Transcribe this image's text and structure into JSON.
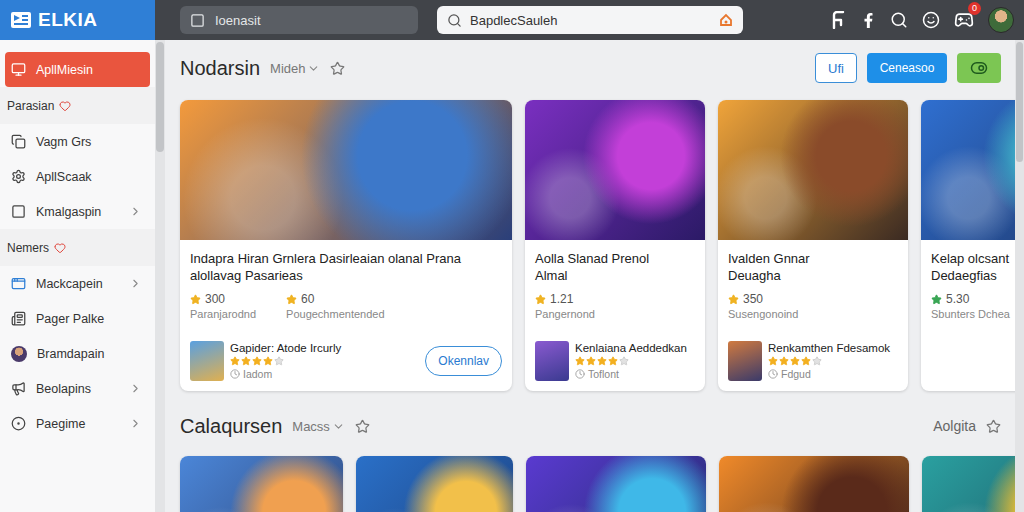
{
  "logo": {
    "text": "ELKIA"
  },
  "top_bar": {
    "search_left": {
      "value": "Ioenasit"
    },
    "search_main": {
      "value": "BapdlecSauleh"
    },
    "notification_badge": "0"
  },
  "sidebar": {
    "items": [
      {
        "kind": "item",
        "label": "ApllMiesin",
        "selected": true,
        "expandable": false
      },
      {
        "kind": "section",
        "label": "Parasian"
      },
      {
        "kind": "item",
        "label": "Vagm Grs",
        "selected": false,
        "expandable": false
      },
      {
        "kind": "item",
        "label": "ApllScaak",
        "selected": false,
        "expandable": false
      },
      {
        "kind": "item",
        "label": "Kmalgaspin",
        "selected": false,
        "expandable": true
      },
      {
        "kind": "section",
        "label": "Nemers"
      },
      {
        "kind": "item",
        "label": "Mackcapein",
        "selected": false,
        "expandable": true
      },
      {
        "kind": "item",
        "label": "Pager Palke",
        "selected": false,
        "expandable": false
      },
      {
        "kind": "item",
        "label": "Bramdapain",
        "selected": false,
        "expandable": false
      },
      {
        "kind": "item",
        "label": "Beolapins",
        "selected": false,
        "expandable": true
      },
      {
        "kind": "item",
        "label": "Paegime",
        "selected": false,
        "expandable": true
      }
    ]
  },
  "sections": [
    {
      "title": "Nodarsin",
      "filter": "Mideh",
      "buttons": [
        "Ufi",
        "Ceneasoo"
      ],
      "cards": [
        {
          "kind": "game",
          "title_lines": [
            "Indapra Hiran Grnlera Dasirleaian olanal Prana",
            "alollavag Pasarieas"
          ],
          "ratings": [
            {
              "value": "300",
              "caption": "Paranjarodnd",
              "color": "#f0b323"
            },
            {
              "value": "60",
              "caption": "Pougechmentended",
              "color": "#f0b323"
            }
          ],
          "game": {
            "name": "Gapider: Atode Ircurly",
            "stars": 4,
            "meta": "Iadom"
          },
          "button": "Okennlav"
        },
        {
          "kind": "game",
          "title_lines": [
            "Aolla Slanad Prenol",
            "Almal"
          ],
          "ratings": [
            {
              "value": "1.21",
              "caption": "Pangernond",
              "color": "#f0b323"
            }
          ],
          "game": {
            "name": "Kenlaiana Aeddedkan",
            "stars": 4,
            "meta": "Toflont"
          }
        },
        {
          "kind": "game",
          "title_lines": [
            "Ivalden Gnnar",
            "Deuagha"
          ],
          "ratings": [
            {
              "value": "350",
              "caption": "Susengonoind",
              "color": "#f0b323"
            }
          ],
          "game": {
            "name": "Renkamthen Fdesamok",
            "stars": 4,
            "meta": "Fdgud"
          }
        },
        {
          "kind": "game",
          "title_lines": [
            "Kelap olcsant",
            "Dedaegfias"
          ],
          "ratings": [
            {
              "value": "5.30",
              "caption": "Sbunters Dchea",
              "color": "#3aa655"
            }
          ]
        }
      ]
    },
    {
      "title": "Calaqursen",
      "filter": "Macss",
      "side_label": "Aolgita",
      "cards": [
        {
          "kind": "image"
        },
        {
          "kind": "image"
        },
        {
          "kind": "image"
        },
        {
          "kind": "image"
        },
        {
          "kind": "image"
        }
      ]
    }
  ]
}
